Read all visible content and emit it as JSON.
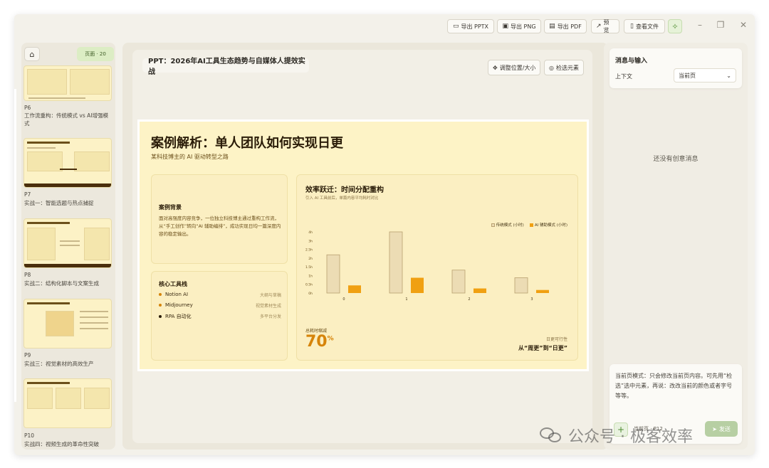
{
  "toolbar": {
    "export_pptx": "导出 PPTX",
    "export_png": "导出 PNG",
    "export_pdf": "导出 PDF",
    "preview": "预览",
    "view_files": "查看文件"
  },
  "sidebar": {
    "page_badge": "页面 · 20",
    "thumbnails": [
      {
        "num": "P6",
        "title": "工作流重构：传统模式 vs AI增强模式"
      },
      {
        "num": "P7",
        "title": "实战一：智能选题与热点捕捉"
      },
      {
        "num": "P8",
        "title": "实战二：结构化脚本与文案生成"
      },
      {
        "num": "P9",
        "title": "实战三：视觉素材的高效生产"
      },
      {
        "num": "P10",
        "title": "实战四：视频生成的革命性突破"
      }
    ]
  },
  "editor": {
    "ppt_title": "PPT：2026年AI工具生态趋势与自媒体人提效实战",
    "adjust_btn": "调整位置/大小",
    "select_btn": "检选元素"
  },
  "slide": {
    "title": "案例解析：单人团队如何实现日更",
    "subtitle": "某科技博主的 AI 驱动转型之路",
    "background": {
      "heading": "案例背景",
      "text": "面对高强度内容竞争，一位独立科技博主通过重构工作流，从“手工创作”转向“AI 辅助编排”，成功实现日均一篇深度内容的稳定输出。"
    },
    "tools": {
      "heading": "核心工具栈",
      "items": [
        {
          "name": "Notion AI",
          "usage": "大纲与草稿",
          "color": "#d6840a"
        },
        {
          "name": "Midjourney",
          "usage": "视觉素材生成",
          "color": "#d6840a"
        },
        {
          "name": "RPA 自动化",
          "usage": "多平台分发",
          "color": "#2a1c08"
        }
      ]
    },
    "chart_panel": {
      "heading": "效率跃迁：时间分配重构",
      "sub": "引入 AI 工具前后，单篇内容平均耗时对比",
      "stat_label": "总耗时缩减",
      "stat_value": "70",
      "stat_unit": "%",
      "side_label": "日更可行性",
      "side_value": "从“周更”到“日更”"
    }
  },
  "chart_data": {
    "type": "bar",
    "categories": [
      "0",
      "1",
      "2",
      "3"
    ],
    "series": [
      {
        "name": "传统模式 (小时)",
        "values": [
          2.5,
          4.0,
          1.5,
          1.0
        ],
        "color": "#ecdcb4"
      },
      {
        "name": "AI 辅助模式 (小时)",
        "values": [
          0.5,
          1.0,
          0.3,
          0.2
        ],
        "color": "#f0a012"
      }
    ],
    "ylim": [
      0,
      4
    ],
    "yticks": [
      "0h",
      "0.5h",
      "1h",
      "1.5h",
      "2h",
      "2.5h",
      "3h",
      "4h"
    ],
    "legend": "top-right",
    "grid": false
  },
  "rpanel": {
    "title": "消息与输入",
    "ctx_label": "上下文",
    "ctx_value": "当前页",
    "empty": "还没有创意消息",
    "input_text": "当前页模式：只会修改当前页内容。可先用“检选”选中元素，再说：改改当前的颜色或者字号等等。",
    "current_page": "当前页 · P12",
    "send": "发送"
  },
  "watermark": {
    "text": "公众号 · 极客效率"
  }
}
